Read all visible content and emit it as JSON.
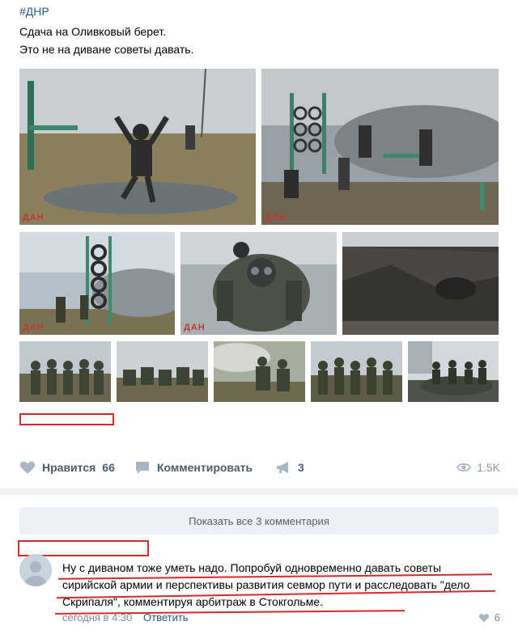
{
  "post": {
    "hashtag": "#ДНР",
    "text_line1": "Сдача на Оливковый берет.",
    "text_line2": "Это не на диване советы давать.",
    "watermark": "ДАН",
    "photos": [
      {
        "id": "p1",
        "alt": "obstacle-course-jump"
      },
      {
        "id": "p2",
        "alt": "tire-tower-smoke"
      },
      {
        "id": "p3",
        "alt": "tire-climb"
      },
      {
        "id": "p4",
        "alt": "gas-mask-soldier"
      },
      {
        "id": "p5",
        "alt": "quarry-slope"
      },
      {
        "id": "p6",
        "alt": "group-1"
      },
      {
        "id": "p7",
        "alt": "group-2"
      },
      {
        "id": "p8",
        "alt": "group-3"
      },
      {
        "id": "p9",
        "alt": "group-4"
      },
      {
        "id": "p10",
        "alt": "group-5"
      }
    ]
  },
  "actions": {
    "like_label": "Нравится",
    "like_count": "66",
    "comment_label": "Комментировать",
    "share_count": "3",
    "views": "1.5K"
  },
  "comments": {
    "show_all": "Показать все 3 комментария",
    "items": [
      {
        "text": "Ну с диваном тоже уметь надо. Попробуй одновременно давать советы сирийской армии и перспективы развития севмор пути и расследовать \"дело Скрипаля\", комментируя арбитраж в Стокгольме.",
        "time": "сегодня в 4:30",
        "reply_label": "Ответить",
        "likes": "6"
      }
    ]
  },
  "colors": {
    "link": "#2a5885",
    "redact_red": "#d32b2b",
    "divider": "#f0f2f5",
    "button_bg": "#edf0f4"
  }
}
